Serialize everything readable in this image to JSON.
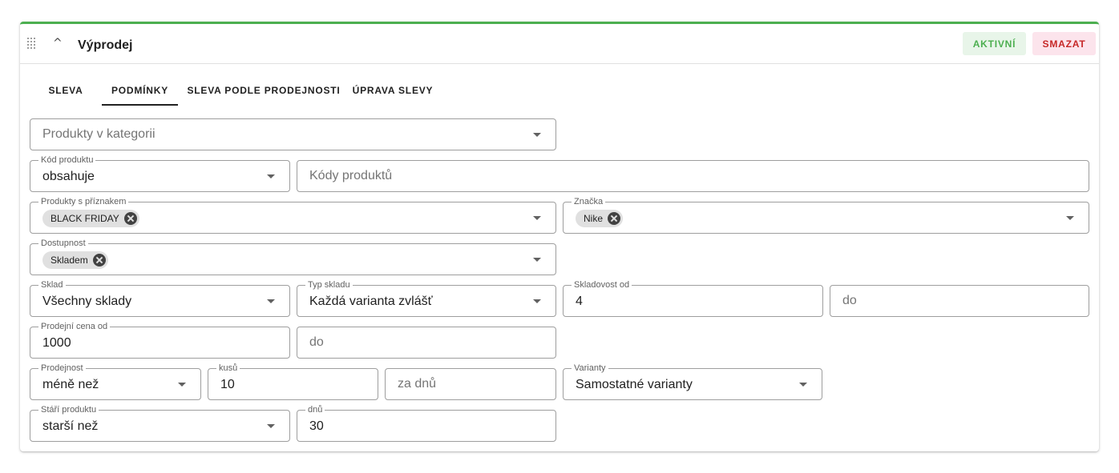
{
  "header": {
    "title": "Výprodej",
    "active_label": "AKTIVNÍ",
    "delete_label": "SMAZAT"
  },
  "tabs": [
    {
      "label": "SLEVA",
      "active": false
    },
    {
      "label": "PODMÍNKY",
      "active": true
    },
    {
      "label": "SLEVA PODLE PRODEJNOSTI",
      "active": false
    },
    {
      "label": "ÚPRAVA SLEVY",
      "active": false
    }
  ],
  "fields": {
    "category": {
      "placeholder": "Produkty v kategorii"
    },
    "product_code": {
      "label": "Kód produktu",
      "value": "obsahuje"
    },
    "product_codes": {
      "placeholder": "Kódy produktů"
    },
    "flagged": {
      "label": "Produkty s příznakem",
      "chip": "BLACK FRIDAY"
    },
    "brand": {
      "label": "Značka",
      "chip": "Nike"
    },
    "availability": {
      "label": "Dostupnost",
      "chip": "Skladem"
    },
    "warehouse": {
      "label": "Sklad",
      "value": "Všechny sklady"
    },
    "warehouse_type": {
      "label": "Typ skladu",
      "value": "Každá varianta zvlášť"
    },
    "stock_from": {
      "label": "Skladovost od",
      "value": "4"
    },
    "stock_to": {
      "placeholder": "do"
    },
    "price_from": {
      "label": "Prodejní cena od",
      "value": "1000"
    },
    "price_to": {
      "placeholder": "do"
    },
    "sales": {
      "label": "Prodejnost",
      "value": "méně než"
    },
    "pieces": {
      "label": "kusů",
      "value": "10"
    },
    "days_window": {
      "placeholder": "za dnů"
    },
    "variants": {
      "label": "Varianty",
      "value": "Samostatné varianty"
    },
    "age": {
      "label": "Stáří produktu",
      "value": "starší než"
    },
    "age_days": {
      "label": "dnů",
      "value": "30"
    }
  },
  "colors": {
    "accent_green": "#4caf50",
    "delete_red": "#c62828"
  }
}
